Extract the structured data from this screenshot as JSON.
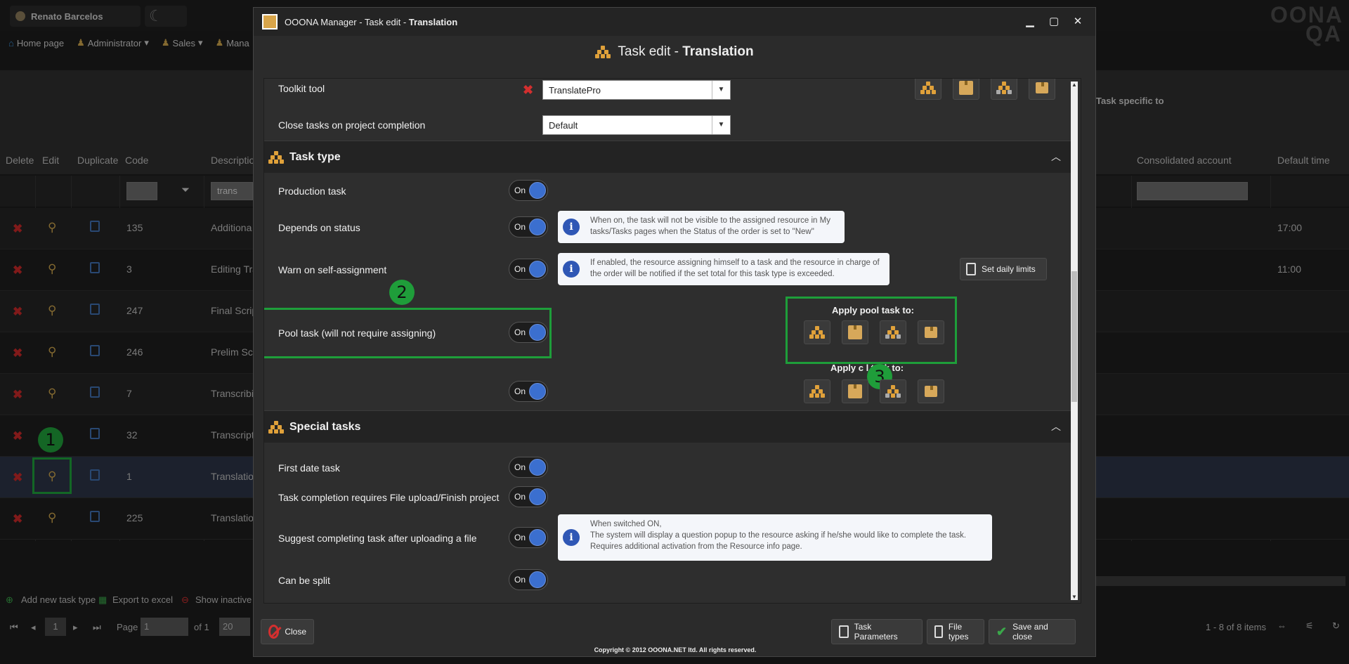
{
  "background": {
    "user_name": "Renato Barcelos",
    "logo_text": "OONA QA",
    "nav": [
      "Home page",
      "Administrator",
      "Sales",
      "Mana"
    ],
    "header_right": "Task specific to",
    "columns": [
      "Delete",
      "Edit",
      "Duplicate",
      "Code",
      "Description",
      "Consolidated account",
      "Default time"
    ],
    "filter_code": "",
    "filter_description": "trans",
    "rows": [
      {
        "code": "135",
        "description": "Additiona",
        "time": "17:00"
      },
      {
        "code": "3",
        "description": "Editing Tra",
        "time": "11:00"
      },
      {
        "code": "247",
        "description": "Final Scrip",
        "time": ""
      },
      {
        "code": "246",
        "description": "Prelim Scr",
        "time": ""
      },
      {
        "code": "7",
        "description": "Transcribi",
        "time": ""
      },
      {
        "code": "32",
        "description": "Transcript",
        "time": ""
      },
      {
        "code": "1",
        "description": "Translatio",
        "time": ""
      },
      {
        "code": "225",
        "description": "Translatio",
        "time": ""
      }
    ],
    "bottom_actions": [
      "Add new task type",
      "Export to excel",
      "Show inactive t"
    ],
    "pager": {
      "current": "1",
      "page_label": "Page",
      "page_value": "1",
      "of": "of 1",
      "page_size": "20",
      "summary": "1 - 8 of 8 items"
    }
  },
  "modal": {
    "window_title_prefix": "OOONA Manager - Task edit - ",
    "window_title_bold": "Translation",
    "header_prefix": "Task edit - ",
    "header_bold": "Translation",
    "toolkit_label": "Toolkit tool",
    "toolkit_value": "TranslatePro",
    "close_tasks_label": "Close tasks on project completion",
    "close_tasks_value": "Default",
    "section_task_type": "Task type",
    "production_task": "Production task",
    "depends_on_status": "Depends on status",
    "depends_info": "When on, the task will not be visible to the assigned resource in My tasks/Tasks pages when the Status of the order is set to \"New\"",
    "warn_self": "Warn on self-assignment",
    "warn_info": "If enabled, the resource assigning himself to a task and the resource in charge of the order will be notified if the set total for this task type is exceeded.",
    "set_daily_limits": "Set daily limits",
    "pool_task": "Pool task (will not require assigning)",
    "apply_pool": "Apply pool task to:",
    "apply_closed": "Apply c     l task to:",
    "toggle_on": "On",
    "section_special": "Special tasks",
    "first_date": "First date task",
    "completion_requires": "Task completion requires File upload/Finish project",
    "suggest_completing": "Suggest completing task after uploading a file",
    "suggest_info": "When switched ON,\nThe system will display a question popup to the resource asking if he/she would like to complete the task.\nRequires additional activation from the Resource info page.",
    "can_be_split": "Can be split",
    "markers": [
      "1",
      "2",
      "3"
    ],
    "btn_close": "Close",
    "btn_task_params": "Task Parameters",
    "btn_file_types": "File types",
    "btn_save_close": "Save and close",
    "copyright": "Copyright © 2012 OOONA.NET ltd. All rights reserved."
  },
  "colors": {
    "accent_blue": "#3b6fcf",
    "highlight_green": "#1e9e3a",
    "delete_red": "#c62828",
    "icon_gold": "#e0a13a"
  }
}
